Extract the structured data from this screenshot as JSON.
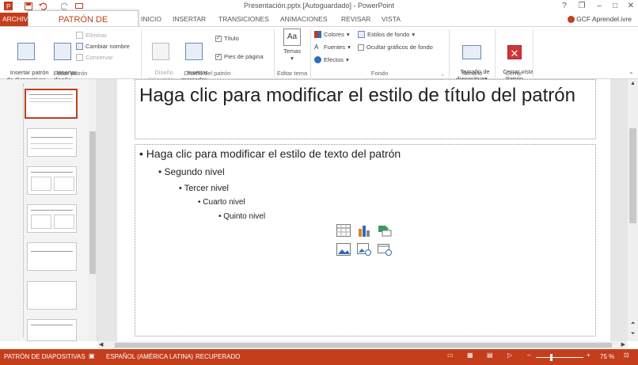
{
  "window": {
    "title": "Presentación.pptx [Autoguardado] - PowerPoint",
    "controls": {
      "help": "?",
      "restore": "❐",
      "minimize": "–",
      "maximize": "□",
      "close": "✕"
    }
  },
  "tabs": {
    "archivo": "ARCHIVO",
    "active": "PATRÓN DE DIAPOSITIVAS",
    "items": [
      "INICIO",
      "INSERTAR",
      "TRANSICIONES",
      "ANIMACIONES",
      "REVISAR",
      "VISTA"
    ],
    "user": "GCF Aprendel.ivre"
  },
  "ribbon": {
    "edit_master": {
      "label": "Editar patrón",
      "insert_master": "Insertar patrón\nde diapositivas",
      "insert_layout": "Insertar\ndiseño",
      "delete": "Eliminar",
      "rename": "Cambiar nombre",
      "preserve": "Conservar"
    },
    "master_layout": {
      "label": "Diseño del patrón",
      "master_layout_btn": "Diseño\ndel patrón",
      "insert_placeholder": "Insertar\nmarcador",
      "title_cb": "Título",
      "footers_cb": "Pies de página"
    },
    "edit_theme": {
      "label": "Editar tema",
      "themes": "Temas"
    },
    "background": {
      "label": "Fondo",
      "colors": "Colores",
      "fonts": "Fuentes",
      "effects": "Efectos",
      "bg_styles": "Estilos de fondo",
      "hide_bg": "Ocultar gráficos de fondo"
    },
    "size": {
      "label": "Tamaño",
      "slide_size": "Tamaño de\ndiapositiva"
    },
    "close": {
      "label": "Cerrar",
      "close_master": "Cerrar vista\nPatrón"
    }
  },
  "slide": {
    "title": "Haga clic para modificar el estilo de título del patrón",
    "levels": [
      "Haga clic para modificar el estilo de texto del patrón",
      "Segundo nivel",
      "Tercer nivel",
      "Cuarto nivel",
      "Quinto nivel"
    ]
  },
  "status": {
    "view": "PATRÓN DE DIAPOSITIVAS",
    "language": "ESPAÑOL (AMÉRICA LATINA)",
    "recovered": "RECUPERADO",
    "zoom": "75 %"
  },
  "colors": {
    "accent": "#c43e1c"
  }
}
